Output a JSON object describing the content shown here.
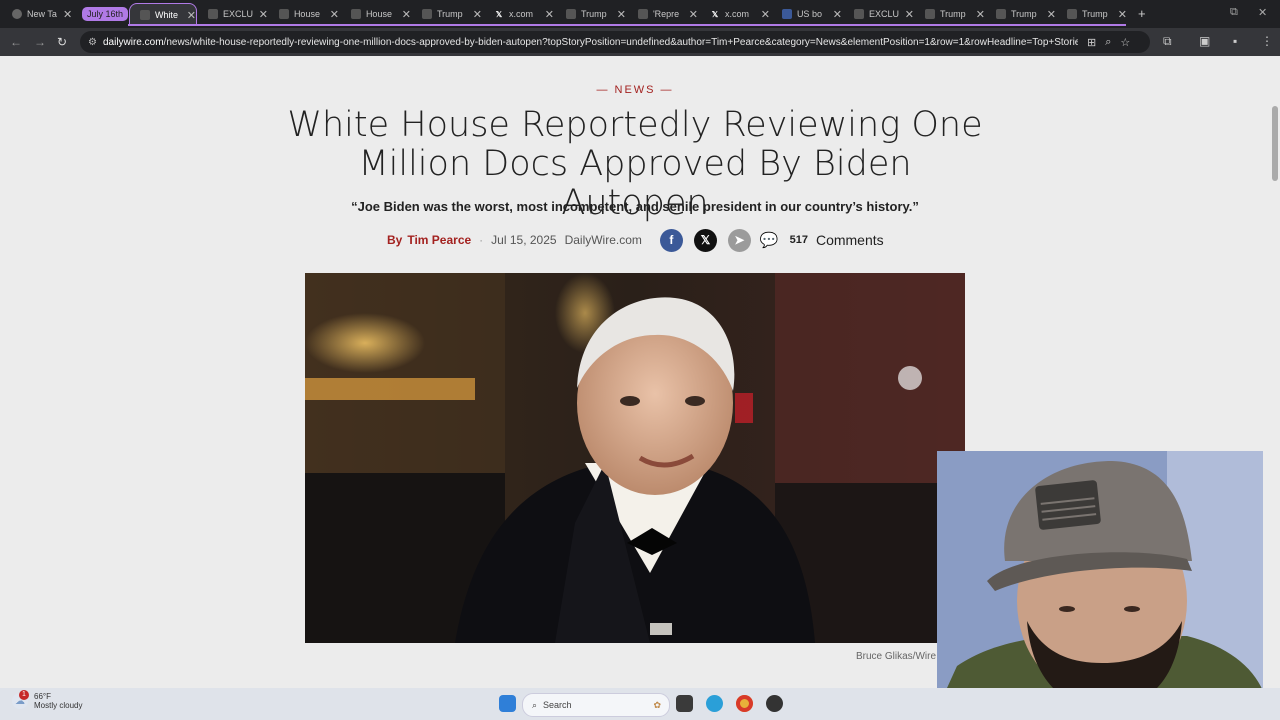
{
  "browser": {
    "group_label": "July 16th",
    "tabs": [
      {
        "label": "New Tab",
        "favicon": "new-tab-icon",
        "active": false
      },
      {
        "label": "White House",
        "favicon": "dailywire-icon",
        "active": true
      },
      {
        "label": "EXCLUSIVE",
        "favicon": "site-icon",
        "active": false
      },
      {
        "label": "House",
        "favicon": "site-icon",
        "active": false
      },
      {
        "label": "House",
        "favicon": "site-icon",
        "active": false
      },
      {
        "label": "Trump",
        "favicon": "site-icon",
        "active": false
      },
      {
        "label": "x.com",
        "favicon": "x-icon",
        "active": false
      },
      {
        "label": "Trump",
        "favicon": "site-icon",
        "active": false
      },
      {
        "label": "'Repre",
        "favicon": "site-icon",
        "active": false
      },
      {
        "label": "x.com",
        "favicon": "x-icon",
        "active": false
      },
      {
        "label": "US bo",
        "favicon": "site-icon",
        "active": false
      },
      {
        "label": "EXCLU",
        "favicon": "site-icon",
        "active": false
      },
      {
        "label": "Trump",
        "favicon": "site-icon",
        "active": false
      },
      {
        "label": "Trump",
        "favicon": "site-icon",
        "active": false
      },
      {
        "label": "Trump",
        "favicon": "site-icon",
        "active": false
      }
    ],
    "url_domain": "dailywire.com",
    "url_path": "/news/white-house-reportedly-reviewing-one-million-docs-approved-by-biden-autopen?topStoryPosition=undefined&author=Tim+Pearce&category=News&elementPosition=1&row=1&rowHeadline=Top+Stories&rowT..."
  },
  "article": {
    "section": "— NEWS —",
    "headline": "White House Reportedly Reviewing One Million Docs Approved By Biden Autopen",
    "subhead": "“Joe Biden was the worst, most incompetent, and senile president in our country’s history.”",
    "by": "By",
    "author": "Tim Pearce",
    "date": "Jul 15, 2025",
    "publisher": "DailyWire.com",
    "comment_count": "517",
    "comments_label": "Comments",
    "photo_credit": "Bruce Glikas/Wire"
  },
  "taskbar": {
    "weather_temp": "66°F",
    "weather_desc": "Mostly cloudy",
    "notification_count": "1",
    "search_label": "Search"
  },
  "colors": {
    "accent_red": "#a32220",
    "tab_group": "#b07ae6",
    "facebook": "#3b5998"
  }
}
